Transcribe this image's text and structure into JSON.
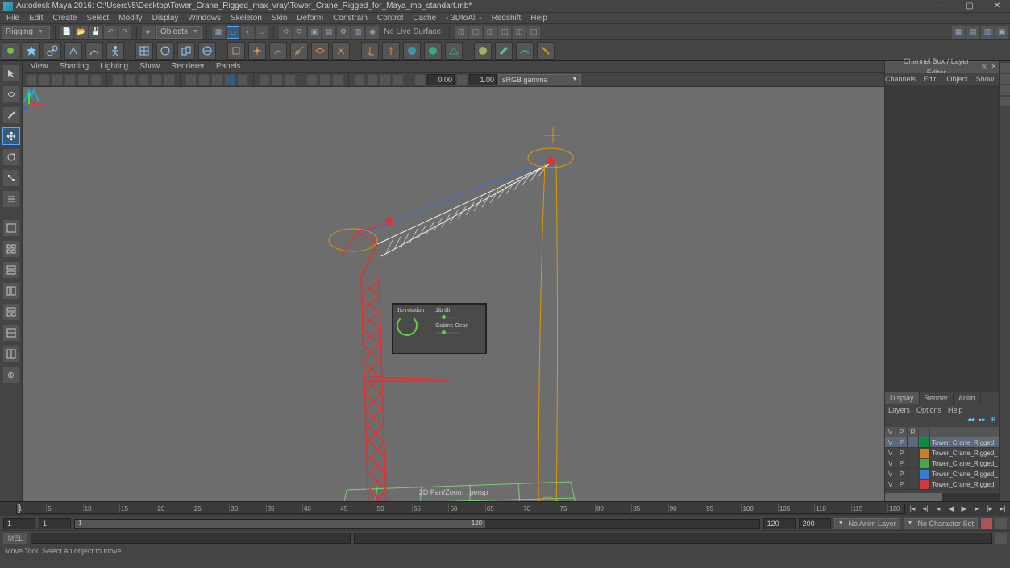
{
  "title": "Autodesk Maya 2016: C:\\Users\\i5\\Desktop\\Tower_Crane_Rigged_max_vray\\Tower_Crane_Rigged_for_Maya_mb_standart.mb*",
  "menus": [
    "File",
    "Edit",
    "Create",
    "Select",
    "Modify",
    "Display",
    "Windows",
    "Skeleton",
    "Skin",
    "Deform",
    "Constrain",
    "Control",
    "Cache",
    "- 3DtoAll -",
    "Redshift",
    "Help"
  ],
  "workspace": "Rigging",
  "mask_mode": "Objects",
  "no_live_surface": "No Live Surface",
  "panel_menus": [
    "View",
    "Shading",
    "Lighting",
    "Show",
    "Renderer",
    "Panels"
  ],
  "exposure": "0.00",
  "gamma": "1.00",
  "color_transform": "sRGB gamma",
  "viewport_label": "2D Pan/Zoom : persp",
  "hud": {
    "jib_rotation": "Jib rotation",
    "jib_tilt": "Jib tilt",
    "cabine_gear": "Cabine Gear"
  },
  "channel_box": {
    "title": "Channel Box / Layer Editor",
    "tabs": [
      "Channels",
      "Edit",
      "Object",
      "Show"
    ],
    "section_tabs": [
      "Display",
      "Render",
      "Anim"
    ],
    "opts": [
      "Layers",
      "Options",
      "Help"
    ],
    "header": [
      "V",
      "P",
      "R"
    ],
    "layers": [
      {
        "v": "V",
        "p": "P",
        "r": "",
        "color": "#0a8a3a",
        "name": "Tower_Crane_Rigged_"
      },
      {
        "v": "V",
        "p": "P",
        "r": "",
        "color": "#d07a2a",
        "name": "Tower_Crane_Rigged_"
      },
      {
        "v": "V",
        "p": "P",
        "r": "",
        "color": "#4aa64a",
        "name": "Tower_Crane_Rigged_"
      },
      {
        "v": "V",
        "p": "P",
        "r": "",
        "color": "#3a7ad0",
        "name": "Tower_Crane_Rigged_"
      },
      {
        "v": "V",
        "p": "P",
        "r": "",
        "color": "#d03a3a",
        "name": "Tower_Crane_Rigged"
      }
    ]
  },
  "time": {
    "ticks": [
      1,
      5,
      10,
      15,
      20,
      25,
      30,
      35,
      40,
      45,
      50,
      55,
      60,
      65,
      70,
      75,
      80,
      85,
      90,
      95,
      100,
      105,
      110,
      115,
      120
    ],
    "start": "1",
    "end": "120",
    "range_start": "1",
    "range_end": "120",
    "out_start": "1",
    "out_end": "200",
    "anim_layer": "No Anim Layer",
    "char_set": "No Character Set"
  },
  "cmd_mode": "MEL",
  "help_text": "Move Tool: Select an object to move."
}
